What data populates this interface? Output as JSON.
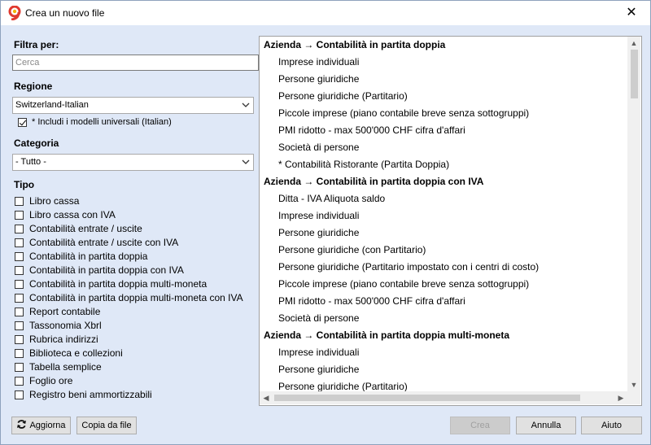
{
  "window": {
    "title": "Crea un nuovo file",
    "close_glyph": "✕"
  },
  "filter": {
    "label": "Filtra per:",
    "search_placeholder": "Cerca"
  },
  "region": {
    "label": "Regione",
    "selected": "Switzerland-Italian",
    "universal_checkbox_label": "* Includi i modelli universali (Italian)",
    "universal_checked": true
  },
  "category": {
    "label": "Categoria",
    "selected": "- Tutto -"
  },
  "type": {
    "label": "Tipo",
    "items": [
      "Libro cassa",
      "Libro cassa con IVA",
      "Contabilità entrate / uscite",
      "Contabilità entrate / uscite con IVA",
      "Contabilità in partita doppia",
      "Contabilità in partita doppia con IVA",
      "Contabilità in partita doppia multi-moneta",
      "Contabilità in partita doppia multi-moneta con IVA",
      "Report contabile",
      "Tassonomia Xbrl",
      "Rubrica indirizzi",
      "Biblioteca e collezioni",
      "Tabella semplice",
      "Foglio ore",
      "Registro beni ammortizzabili"
    ]
  },
  "templates": [
    {
      "text": "Azienda → Contabilità in partita doppia",
      "kind": "head"
    },
    {
      "text": "Imprese individuali",
      "kind": "item"
    },
    {
      "text": "Persone giuridiche",
      "kind": "item"
    },
    {
      "text": "Persone giuridiche (Partitario)",
      "kind": "item"
    },
    {
      "text": "Piccole imprese (piano contabile breve senza sottogruppi)",
      "kind": "item"
    },
    {
      "text": "PMI ridotto - max 500'000 CHF cifra d'affari",
      "kind": "item"
    },
    {
      "text": "Società di persone",
      "kind": "item"
    },
    {
      "text": "* Contabilità Ristorante (Partita Doppia)",
      "kind": "item"
    },
    {
      "text": "Azienda → Contabilità in partita doppia con IVA",
      "kind": "head"
    },
    {
      "text": "Ditta - IVA Aliquota saldo",
      "kind": "item"
    },
    {
      "text": "Imprese individuali",
      "kind": "item"
    },
    {
      "text": "Persone giuridiche",
      "kind": "item"
    },
    {
      "text": "Persone giuridiche (con Partitario)",
      "kind": "item"
    },
    {
      "text": "Persone giuridiche (Partitario impostato con i centri di costo)",
      "kind": "item"
    },
    {
      "text": "Piccole imprese (piano contabile breve senza sottogruppi)",
      "kind": "item"
    },
    {
      "text": "PMI ridotto - max 500'000 CHF cifra d'affari",
      "kind": "item"
    },
    {
      "text": "Società di persone",
      "kind": "item"
    },
    {
      "text": "Azienda → Contabilità in partita doppia multi-moneta",
      "kind": "head"
    },
    {
      "text": "Imprese individuali",
      "kind": "item"
    },
    {
      "text": "Persone giuridiche",
      "kind": "item"
    },
    {
      "text": "Persone giuridiche (Partitario)",
      "kind": "item"
    }
  ],
  "buttons": {
    "refresh": "Aggiorna",
    "copy_from_file": "Copia da file",
    "create": "Crea",
    "cancel": "Annulla",
    "help": "Aiuto"
  },
  "colors": {
    "dialog_bg": "#dfe8f7",
    "app_icon_red": "#e03a2f",
    "app_icon_yellow": "#f2b400"
  }
}
